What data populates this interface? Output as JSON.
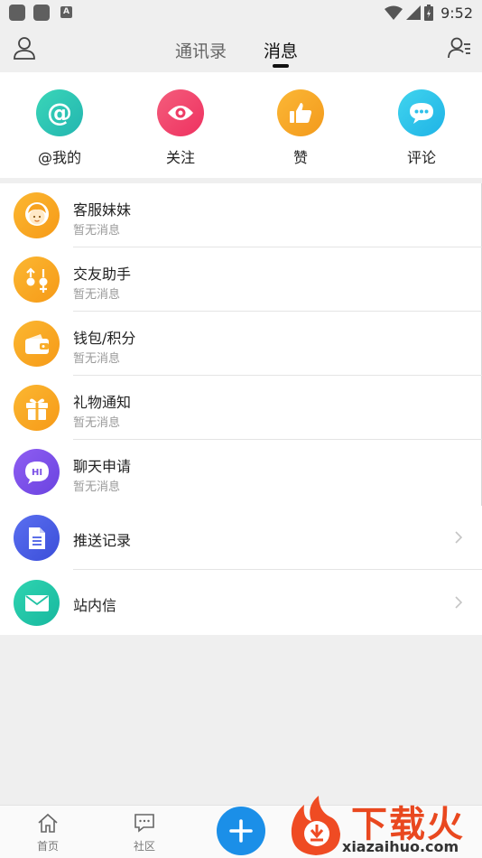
{
  "status_bar": {
    "time": "9:52"
  },
  "top_nav": {
    "tabs": [
      {
        "label": "通讯录",
        "active": false
      },
      {
        "label": "消息",
        "active": true
      }
    ]
  },
  "quick_actions": [
    {
      "label": "@我的",
      "icon": "at-icon",
      "color": "#2fc2b2"
    },
    {
      "label": "关注",
      "icon": "eye-icon",
      "color": "#f0456a"
    },
    {
      "label": "赞",
      "icon": "thumbs-up-icon",
      "color": "#f7a623"
    },
    {
      "label": "评论",
      "icon": "comment-icon",
      "color": "#2ec5e8"
    }
  ],
  "messages": [
    {
      "title": "客服妹妹",
      "subtitle": "暂无消息",
      "icon": "service-girl-icon",
      "color": "#f9a51e"
    },
    {
      "title": "交友助手",
      "subtitle": "暂无消息",
      "icon": "friend-assistant-icon",
      "color": "#f9a51e"
    },
    {
      "title": "钱包/积分",
      "subtitle": "暂无消息",
      "icon": "wallet-icon",
      "color": "#f9a51e"
    },
    {
      "title": "礼物通知",
      "subtitle": "暂无消息",
      "icon": "gift-icon",
      "color": "#f9a51e"
    },
    {
      "title": "聊天申请",
      "subtitle": "暂无消息",
      "icon": "chat-hi-icon",
      "color": "#7b4fe6"
    }
  ],
  "links": [
    {
      "title": "推送记录",
      "icon": "document-icon",
      "color": "#4a5fe6"
    },
    {
      "title": "站内信",
      "icon": "mail-icon",
      "color": "#21c7a6"
    }
  ],
  "bottom_bar": {
    "items": [
      {
        "label": "首页",
        "icon": "home-icon"
      },
      {
        "label": "社区",
        "icon": "community-icon"
      }
    ],
    "fab_icon": "plus-icon"
  },
  "watermark": {
    "brand": "下载火",
    "url": "xiazaihuo.com"
  }
}
